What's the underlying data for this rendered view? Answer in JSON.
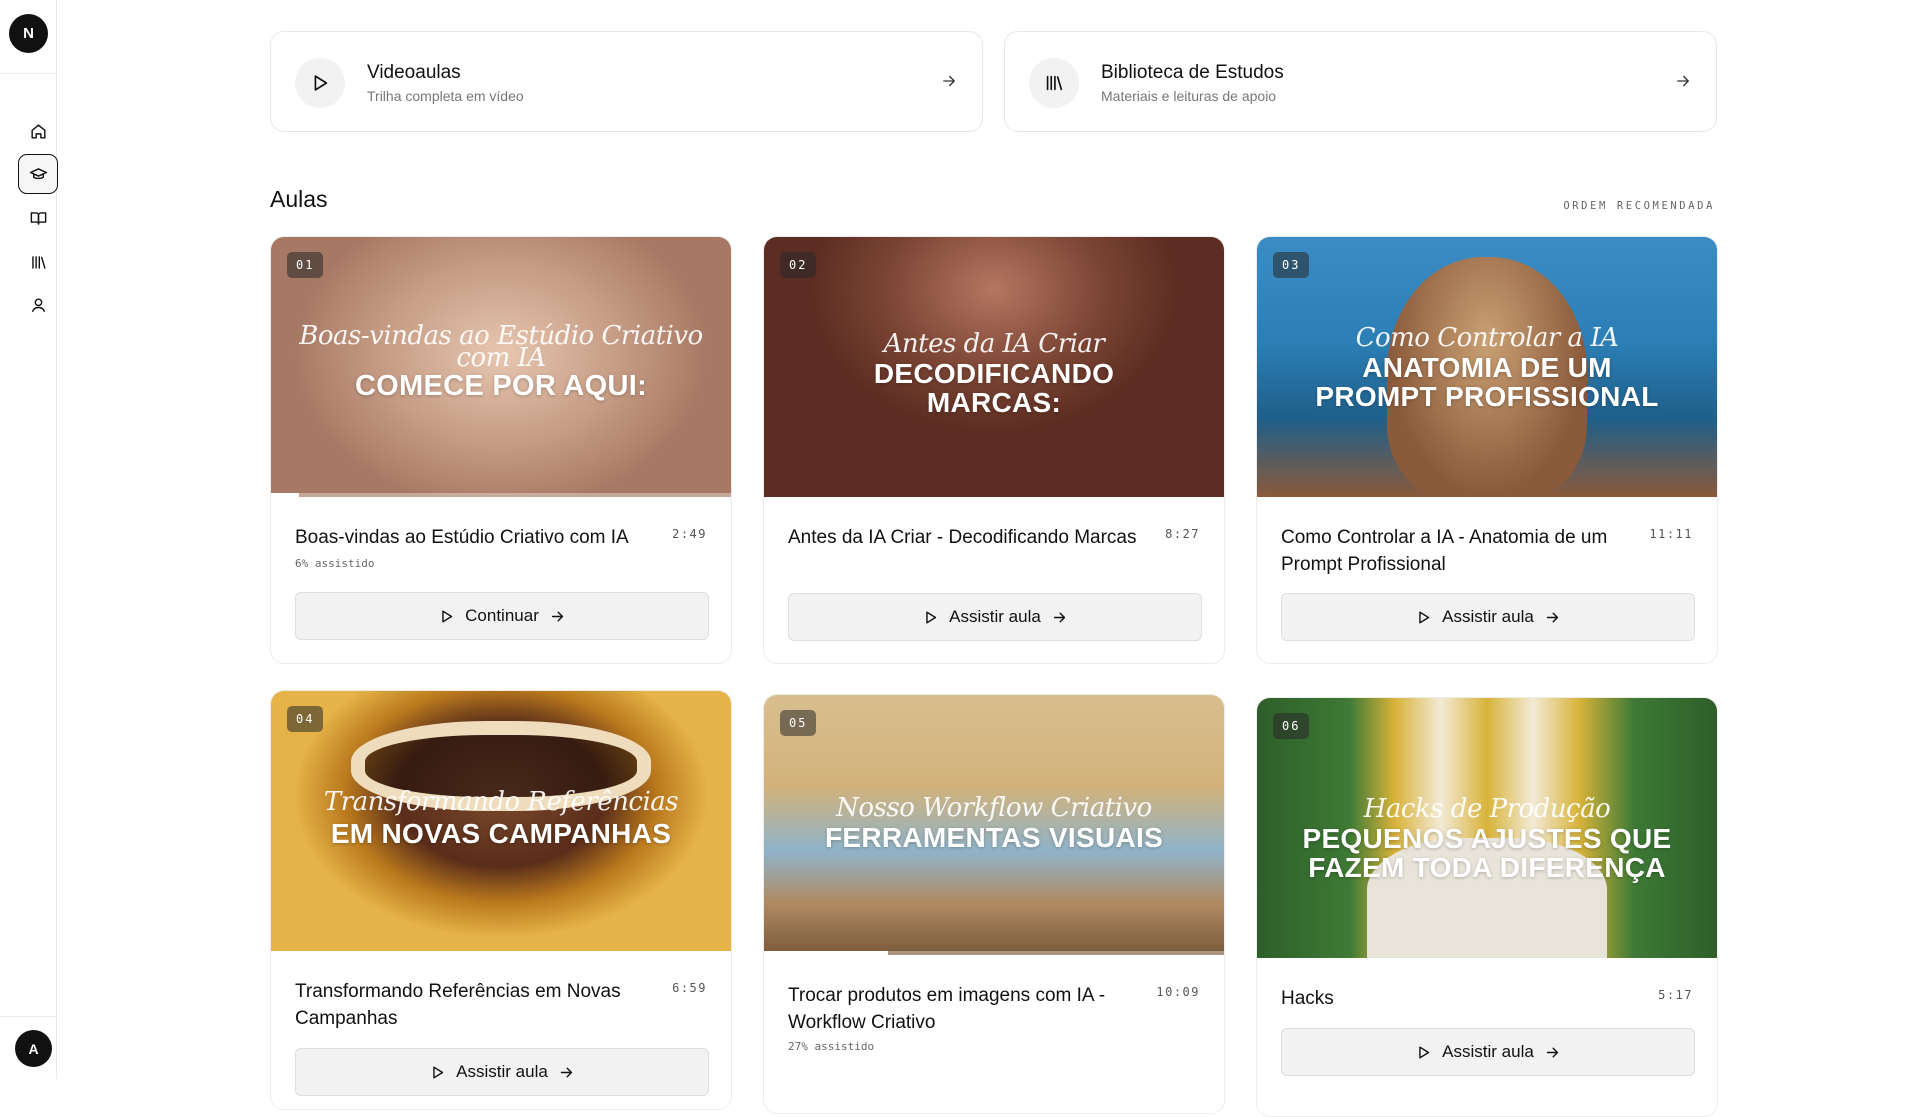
{
  "sidebar": {
    "logo_letter": "N",
    "avatar_letter": "A",
    "nav": [
      {
        "name": "home",
        "icon": "home-icon",
        "active": false
      },
      {
        "name": "courses",
        "icon": "graduation-cap-icon",
        "active": true
      },
      {
        "name": "reading",
        "icon": "open-book-icon",
        "active": false
      },
      {
        "name": "library",
        "icon": "library-icon",
        "active": false
      },
      {
        "name": "profile",
        "icon": "user-icon",
        "active": false
      }
    ]
  },
  "features": [
    {
      "title": "Videoaulas",
      "subtitle": "Trilha completa em vídeo",
      "icon": "play-icon"
    },
    {
      "title": "Biblioteca de Estudos",
      "subtitle": "Materiais e leituras de apoio",
      "icon": "library-icon"
    }
  ],
  "section": {
    "title": "Aulas",
    "order_label": "ORDEM RECOMENDADA"
  },
  "lessons": [
    {
      "number": "01",
      "title": "Boas-vindas ao Estúdio Criativo com IA",
      "duration": "2:49",
      "watched": "6% assistido",
      "progress": 0.06,
      "button": "Continuar",
      "thumb_script": "Boas-vindas ao Estúdio Criativo com IA",
      "thumb_headline": "COMECE POR AQUI:",
      "bg_colors": [
        "#c49a82",
        "#e7c6b0",
        "#a77964"
      ]
    },
    {
      "number": "02",
      "title": "Antes da IA Criar - Decodificando Marcas",
      "duration": "8:27",
      "watched": "",
      "progress": 0,
      "button": "Assistir aula",
      "thumb_script": "Antes da IA Criar",
      "thumb_headline": "DECODIFICANDO MARCAS:",
      "bg_colors": [
        "#7a4433",
        "#b57661",
        "#5c2d22"
      ]
    },
    {
      "number": "03",
      "title": "Como Controlar a IA - Anatomia de um Prompt Profissional",
      "duration": "11:11",
      "watched": "",
      "progress": 0,
      "button": "Assistir aula",
      "thumb_script": "Como Controlar a IA",
      "thumb_headline": "ANATOMIA DE UM PROMPT PROFISSIONAL",
      "bg_colors": [
        "#2c7fb6",
        "#8b5a3a",
        "#c9a074"
      ]
    },
    {
      "number": "04",
      "title": "Transformando Referências em Novas Campanhas",
      "duration": "6:59",
      "watched": "",
      "progress": 0,
      "button": "Assistir aula",
      "thumb_script": "Transformando Referências",
      "thumb_headline": "EM NOVAS CAMPANHAS",
      "bg_colors": [
        "#b9781d",
        "#e5b347",
        "#5a2d1a"
      ]
    },
    {
      "number": "05",
      "title": "Trocar produtos em imagens com IA - Workflow Criativo",
      "duration": "10:09",
      "watched": "27% assistido",
      "progress": 0.27,
      "button": "Assistir aula",
      "thumb_script": "Nosso Workflow Criativo",
      "thumb_headline": "FERRAMENTAS VISUAIS",
      "bg_colors": [
        "#d2b27a",
        "#8fb3c9",
        "#7a5a3c"
      ]
    },
    {
      "number": "06",
      "title": "Hacks",
      "duration": "5:17",
      "watched": "",
      "progress": 0,
      "button": "Assistir aula",
      "thumb_script": "Hacks de Produção",
      "thumb_headline": "PEQUENOS AJUSTES QUE FAZEM TODA DIFERENÇA",
      "bg_colors": [
        "#2e5e2a",
        "#d8b33a",
        "#e9e4da"
      ]
    }
  ]
}
